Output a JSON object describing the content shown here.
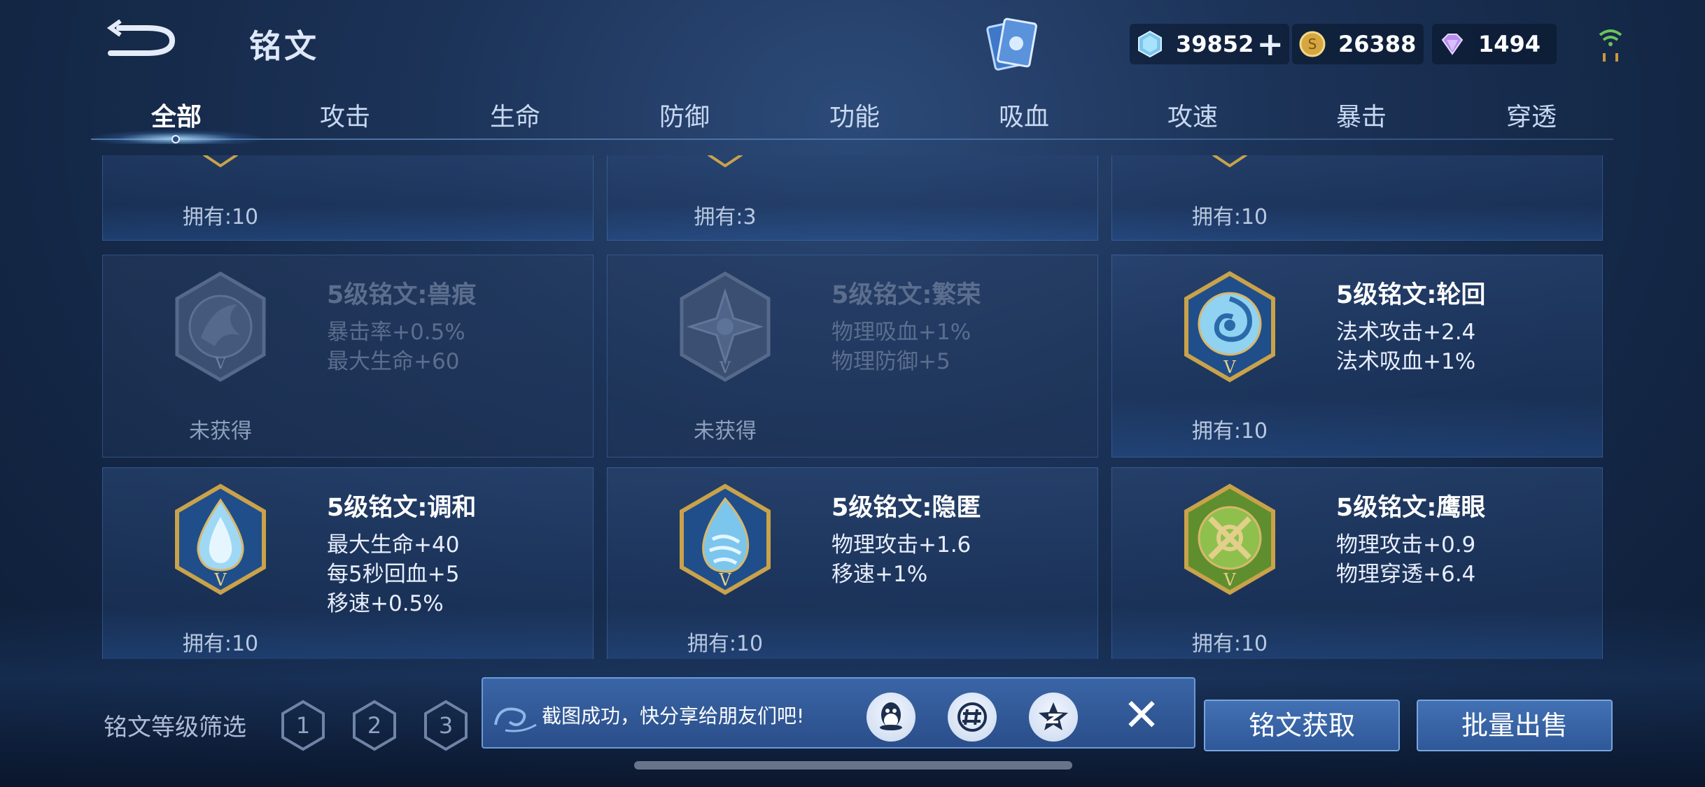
{
  "header": {
    "title": "铭文",
    "back_icon": "back-arrow-icon",
    "currencies": [
      {
        "icon": "crystal-icon",
        "value": "39852",
        "has_plus": true
      },
      {
        "icon": "gold-coin-icon",
        "value": "26388"
      },
      {
        "icon": "diamond-icon",
        "value": "1494"
      }
    ]
  },
  "tabs": [
    {
      "label": "全部",
      "active": true
    },
    {
      "label": "攻击"
    },
    {
      "label": "生命"
    },
    {
      "label": "防御"
    },
    {
      "label": "功能"
    },
    {
      "label": "吸血"
    },
    {
      "label": "攻速"
    },
    {
      "label": "暴击"
    },
    {
      "label": "穿透"
    }
  ],
  "cards_row0": [
    {
      "owned": "拥有:10"
    },
    {
      "owned": "拥有:3"
    },
    {
      "owned": "拥有:10"
    }
  ],
  "cards": [
    {
      "name": "5级铭文:兽痕",
      "stats": [
        "暴击率+0.5%",
        "最大生命+60"
      ],
      "owned": "未获得",
      "acquired": false,
      "color": "gray",
      "icon": "beast-claw-rune-icon"
    },
    {
      "name": "5级铭文:繁荣",
      "stats": [
        "物理吸血+1%",
        "物理防御+5"
      ],
      "owned": "未获得",
      "acquired": false,
      "color": "gray",
      "icon": "star-rune-icon"
    },
    {
      "name": "5级铭文:轮回",
      "stats": [
        "法术攻击+2.4",
        "法术吸血+1%"
      ],
      "owned": "拥有:10",
      "acquired": true,
      "color": "blue",
      "icon": "swirl-rune-icon"
    },
    {
      "name": "5级铭文:调和",
      "stats": [
        "最大生命+40",
        "每5秒回血+5",
        "移速+0.5%"
      ],
      "owned": "拥有:10",
      "acquired": true,
      "color": "blue",
      "icon": "drop-rune-icon"
    },
    {
      "name": "5级铭文:隐匿",
      "stats": [
        "物理攻击+1.6",
        "移速+1%"
      ],
      "owned": "拥有:10",
      "acquired": true,
      "color": "blue",
      "icon": "flame-rune-icon"
    },
    {
      "name": "5级铭文:鹰眼",
      "stats": [
        "物理攻击+0.9",
        "物理穿透+6.4"
      ],
      "owned": "拥有:10",
      "acquired": true,
      "color": "green",
      "icon": "crosshair-rune-icon"
    }
  ],
  "filter": {
    "label": "铭文等级筛选",
    "levels": [
      "1",
      "2",
      "3"
    ]
  },
  "toast": {
    "text": "截图成功，快分享给朋友们吧!",
    "share_icons": [
      "qq-icon",
      "wechat-moments-icon",
      "qzone-icon"
    ],
    "close": "✕"
  },
  "buttons": {
    "acquire": "铭文获取",
    "sell": "批量出售"
  },
  "colors": {
    "accent": "#3d6aae",
    "gold": "#c9a24a",
    "blue_rune": "#8fd2f2",
    "green_rune": "#7fb84a"
  }
}
